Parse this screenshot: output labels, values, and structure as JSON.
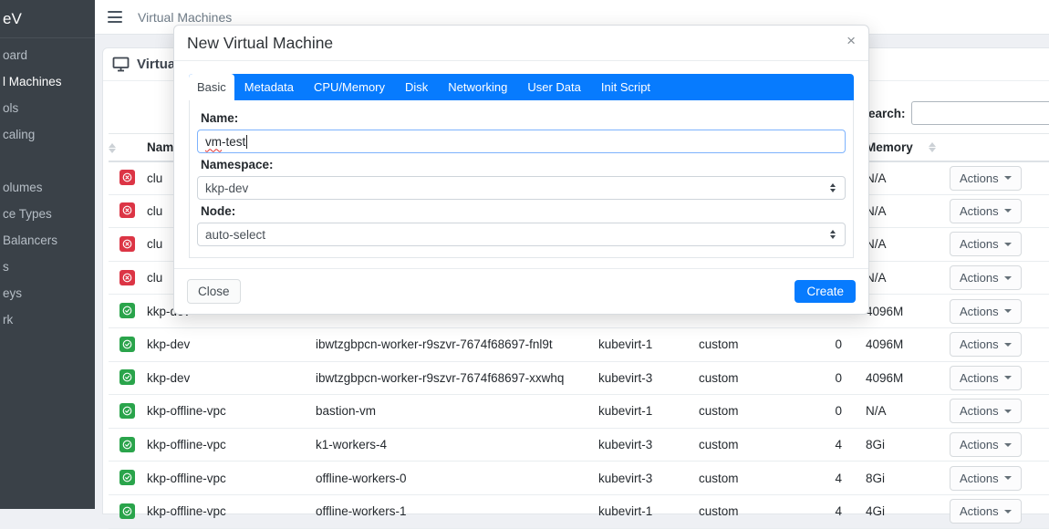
{
  "colors": {
    "accent": "#077bfe",
    "success": "#2aa44b",
    "danger": "#dc3545",
    "sidebar": "#3a4148"
  },
  "sidebar": {
    "logo_fragment": "eV",
    "items": [
      {
        "label": "oard",
        "active": false,
        "gap": false
      },
      {
        "label": "l Machines",
        "active": true,
        "gap": false
      },
      {
        "label": "ols",
        "active": false,
        "gap": false
      },
      {
        "label": "caling",
        "active": false,
        "gap": false
      },
      {
        "label": "olumes",
        "active": false,
        "gap": true
      },
      {
        "label": "ce Types",
        "active": false,
        "gap": false
      },
      {
        "label": "Balancers",
        "active": false,
        "gap": false
      },
      {
        "label": "s",
        "active": false,
        "gap": false
      },
      {
        "label": "eys",
        "active": false,
        "gap": false
      },
      {
        "label": "rk",
        "active": false,
        "gap": false
      }
    ]
  },
  "navbar": {
    "title": "Virtual Machines"
  },
  "card": {
    "title": "Virtual Machines"
  },
  "search": {
    "label": "Search:",
    "value": ""
  },
  "table": {
    "headers": {
      "status": "",
      "namespace": "Namespace",
      "name": "",
      "node": "",
      "type": "",
      "cpus": "",
      "memory": "Memory",
      "actions": ""
    },
    "actions_label": "Actions",
    "rows": [
      {
        "status": "error",
        "namespace": "clu",
        "name": "",
        "node": "",
        "type": "",
        "cpus": "",
        "memory": "N/A"
      },
      {
        "status": "error",
        "namespace": "clu",
        "name": "",
        "node": "",
        "type": "",
        "cpus": "",
        "memory": "N/A"
      },
      {
        "status": "error",
        "namespace": "clu",
        "name": "",
        "node": "",
        "type": "",
        "cpus": "",
        "memory": "N/A"
      },
      {
        "status": "error",
        "namespace": "clu",
        "name": "",
        "node": "",
        "type": "",
        "cpus": "",
        "memory": "N/A"
      },
      {
        "status": "ok",
        "namespace": "kkp-dev",
        "name": "",
        "node": "",
        "type": "",
        "cpus": "",
        "memory": "4096M"
      },
      {
        "status": "ok",
        "namespace": "kkp-dev",
        "name": "ibwtzgbpcn-worker-r9szvr-7674f68697-fnl9t",
        "node": "kubevirt-1",
        "type": "custom",
        "cpus": "0",
        "memory": "4096M"
      },
      {
        "status": "ok",
        "namespace": "kkp-dev",
        "name": "ibwtzgbpcn-worker-r9szvr-7674f68697-xxwhq",
        "node": "kubevirt-3",
        "type": "custom",
        "cpus": "0",
        "memory": "4096M"
      },
      {
        "status": "ok",
        "namespace": "kkp-offline-vpc",
        "name": "bastion-vm",
        "node": "kubevirt-1",
        "type": "custom",
        "cpus": "0",
        "memory": "N/A"
      },
      {
        "status": "ok",
        "namespace": "kkp-offline-vpc",
        "name": "k1-workers-4",
        "node": "kubevirt-3",
        "type": "custom",
        "cpus": "4",
        "memory": "8Gi"
      },
      {
        "status": "ok",
        "namespace": "kkp-offline-vpc",
        "name": "offline-workers-0",
        "node": "kubevirt-3",
        "type": "custom",
        "cpus": "4",
        "memory": "8Gi"
      },
      {
        "status": "ok",
        "namespace": "kkp-offline-vpc",
        "name": "offline-workers-1",
        "node": "kubevirt-1",
        "type": "custom",
        "cpus": "4",
        "memory": "4Gi"
      }
    ]
  },
  "modal": {
    "title": "New Virtual Machine",
    "close_icon": "×",
    "tabs": [
      {
        "label": "Basic",
        "active": true
      },
      {
        "label": "Metadata",
        "active": false
      },
      {
        "label": "CPU/Memory",
        "active": false
      },
      {
        "label": "Disk",
        "active": false
      },
      {
        "label": "Networking",
        "active": false
      },
      {
        "label": "User Data",
        "active": false
      },
      {
        "label": "Init Script",
        "active": false
      }
    ],
    "form": {
      "name_label": "Name:",
      "name_value": "vm-test",
      "name_value_misspelled_part": "vm",
      "name_value_rest_part": "-test",
      "namespace_label": "Namespace:",
      "namespace_value": "kkp-dev",
      "node_label": "Node:",
      "node_value": "auto-select"
    },
    "footer": {
      "close_label": "Close",
      "create_label": "Create"
    }
  }
}
